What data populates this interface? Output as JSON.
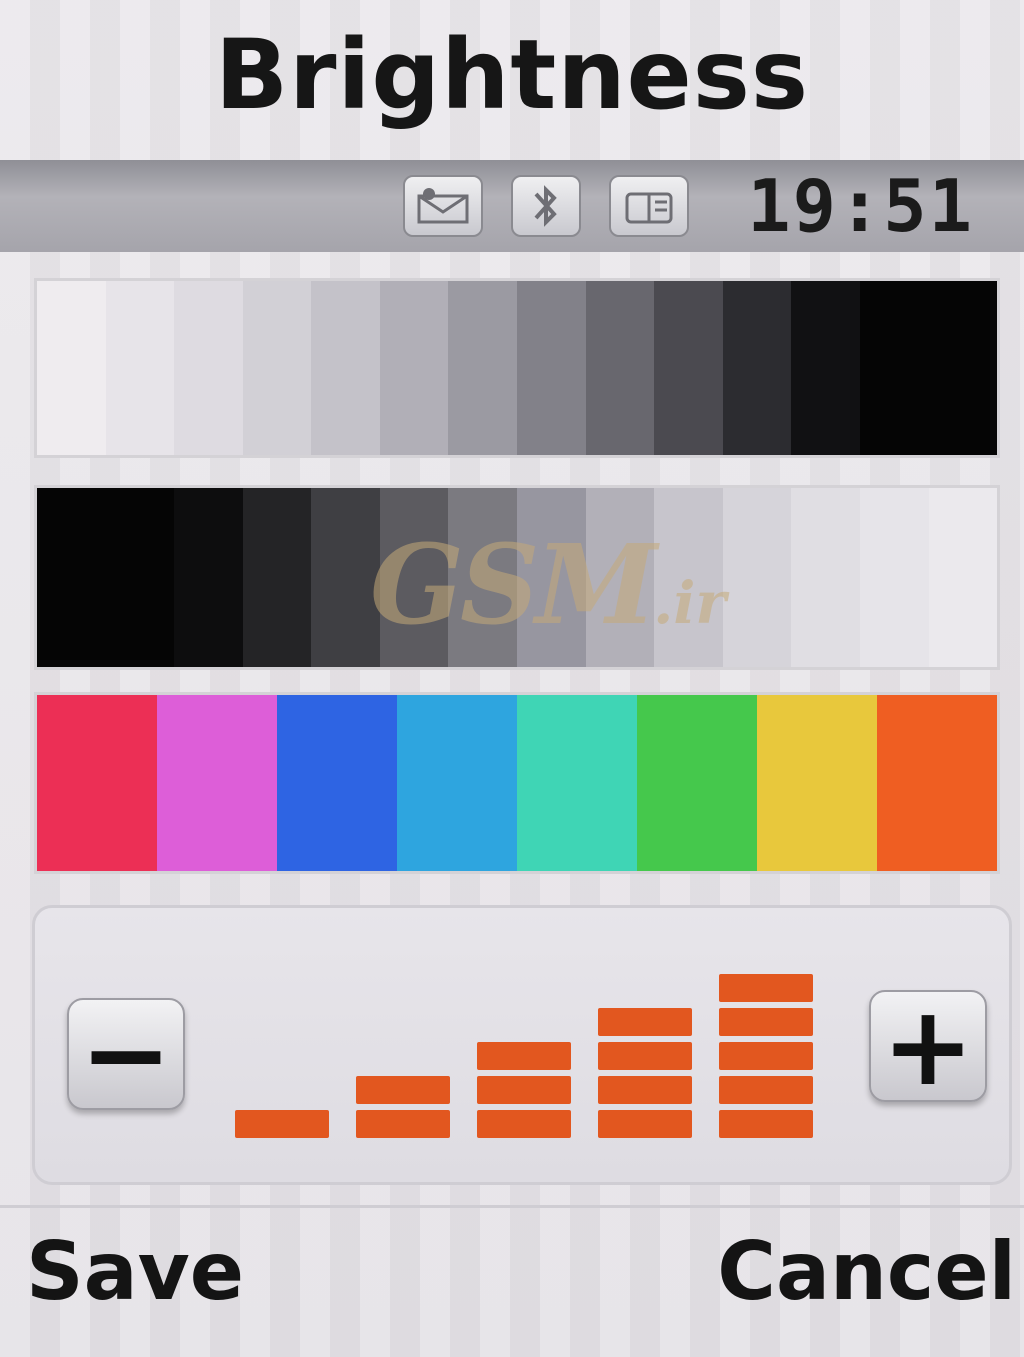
{
  "header": {
    "title": "Brightness"
  },
  "status_bar": {
    "time": "19:51",
    "icons": [
      "message-icon",
      "bluetooth-icon",
      "phonebook-icon"
    ]
  },
  "gradient_strips": {
    "light_to_dark": [
      "#efecef",
      "#e7e4e9",
      "#dedbe1",
      "#d2d0d6",
      "#c4c2c9",
      "#b1afb7",
      "#9b9aa2",
      "#828189",
      "#68676e",
      "#4b4a50",
      "#2c2c30",
      "#111113",
      "#050505",
      "#050505"
    ],
    "dark_to_light": [
      "#050505",
      "#050505",
      "#0d0d0e",
      "#242426",
      "#3f3f43",
      "#5c5b60",
      "#7b7a80",
      "#9796a0",
      "#b2b0b8",
      "#c7c5cc",
      "#d6d4da",
      "#e0dee3",
      "#e6e4e9",
      "#ebe9ed"
    ],
    "colors": [
      "#ec2f55",
      "#dd5ed8",
      "#2e64e3",
      "#2ea5df",
      "#3fd5b5",
      "#45c84c",
      "#e8c83c",
      "#ef5e22"
    ]
  },
  "watermark": {
    "main": "GSM",
    "suffix": ".ir"
  },
  "brightness": {
    "decrease_label": "−",
    "increase_label": "+",
    "level": 5,
    "max_level": 5,
    "bar_color": "#e2571f"
  },
  "softkeys": {
    "left": "Save",
    "right": "Cancel"
  }
}
